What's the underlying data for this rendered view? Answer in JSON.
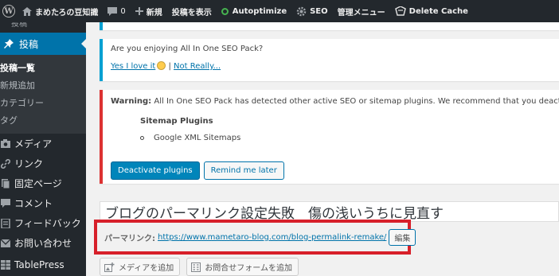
{
  "adminbar": {
    "site_name": "まめたろの豆知識",
    "comments_count": "0",
    "new_label": "新規",
    "view_post": "投稿を表示",
    "autoptimize": "Autoptimize",
    "seo": "SEO",
    "admin_menu": "管理メニュー",
    "delete_cache": "Delete Cache"
  },
  "sidebar": {
    "cut_item": "投稿",
    "posts": "投稿",
    "submenu": [
      "投稿一覧",
      "新規追加",
      "カテゴリー",
      "タグ"
    ],
    "items": [
      {
        "label": "メディア",
        "icon": "media-icon"
      },
      {
        "label": "リンク",
        "icon": "links-icon"
      },
      {
        "label": "固定ページ",
        "icon": "pages-icon"
      },
      {
        "label": "コメント",
        "icon": "comments-icon"
      },
      {
        "label": "フィードバック",
        "icon": "feedback-icon"
      },
      {
        "label": "お問い合わせ",
        "icon": "contact-icon"
      },
      {
        "label": "TablePress",
        "icon": "tablepress-icon"
      }
    ]
  },
  "aio_notice": {
    "question": "Are you enjoying All In One SEO Pack?",
    "love_link": "Yes I love it",
    "separator": "|",
    "not_really_link": "Not Really..."
  },
  "warning_notice": {
    "warning_label": "Warning:",
    "message": "All In One SEO Pack has detected other active SEO or sitemap plugins. We recommend that you deactivate the followin",
    "plugins_title": "Sitemap Plugins",
    "plugin": "Google XML Sitemaps",
    "deactivate_button": "Deactivate plugins",
    "remind_button": "Remind me later"
  },
  "post": {
    "title": "ブログのパーマリンク設定失敗　傷の浅いうちに見直す",
    "permalink_label": "パーマリンク:",
    "permalink_url": "https://www.mametaro-blog.com/blog-permalink-remake/",
    "edit_button": "編集",
    "add_media": "メディアを追加",
    "add_form": "お問合せフォームを追加"
  },
  "colors": {
    "adminbar_bg": "#23282d",
    "active_menu": "#0073aa",
    "notice_info": "#00a0d2",
    "notice_error": "#dc3232",
    "highlight_box": "#d7202a"
  }
}
